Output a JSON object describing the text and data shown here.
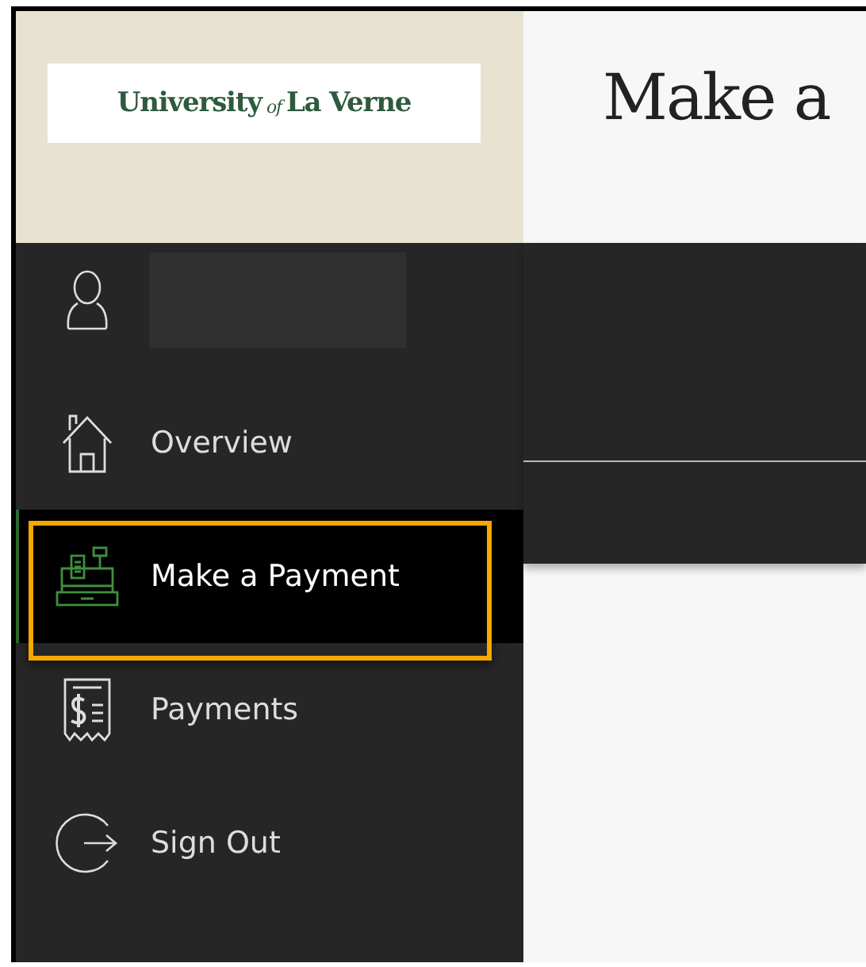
{
  "logo": {
    "name": "University",
    "connector": "of",
    "place": "La Verne"
  },
  "page": {
    "title": "Make a"
  },
  "user": {
    "name_redacted": true
  },
  "nav": [
    {
      "kind": "overview",
      "label": "Overview",
      "selected": false,
      "highlighted": false
    },
    {
      "kind": "payment",
      "label": "Make a Payment",
      "selected": true,
      "highlighted": true
    },
    {
      "kind": "payments",
      "label": "Payments",
      "selected": false,
      "highlighted": false
    },
    {
      "kind": "signout",
      "label": "Sign Out",
      "selected": false,
      "highlighted": false
    }
  ]
}
